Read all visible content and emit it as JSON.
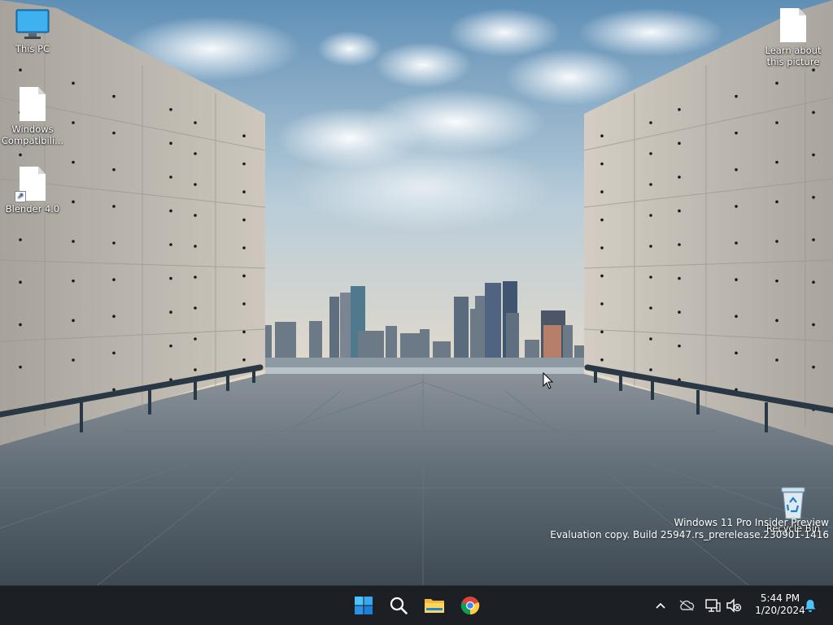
{
  "desktop": {
    "icons": [
      {
        "label": "This PC",
        "icon": "this-pc-icon"
      },
      {
        "label": "Windows Compatibili...",
        "icon": "document-icon"
      },
      {
        "label": "Blender 4.0",
        "icon": "shortcut-icon"
      },
      {
        "label": "Learn about this picture",
        "icon": "document-icon"
      },
      {
        "label": "Recycle Bin",
        "icon": "recycle-bin-icon"
      }
    ],
    "watermark": {
      "line1": "Windows 11 Pro Insider Preview",
      "line2": "Evaluation copy. Build 25947.rs_prerelease.230901-1416"
    }
  },
  "taskbar": {
    "apps": [
      {
        "name": "Start",
        "icon": "windows-logo-icon"
      },
      {
        "name": "Search",
        "icon": "search-icon"
      },
      {
        "name": "File Explorer",
        "icon": "folder-icon"
      },
      {
        "name": "Google Chrome",
        "icon": "chrome-icon"
      }
    ],
    "tray": {
      "icons": [
        "chevron-up-icon",
        "onedrive-icon",
        "network-icon",
        "volume-muted-icon",
        "notification-bell-icon"
      ],
      "time": "5:44 PM",
      "date": "1/20/2024"
    }
  },
  "colors": {
    "taskbar_bg": "#1c1f24",
    "accent": "#0078d4",
    "sky_blue": "#7ea7c6"
  }
}
